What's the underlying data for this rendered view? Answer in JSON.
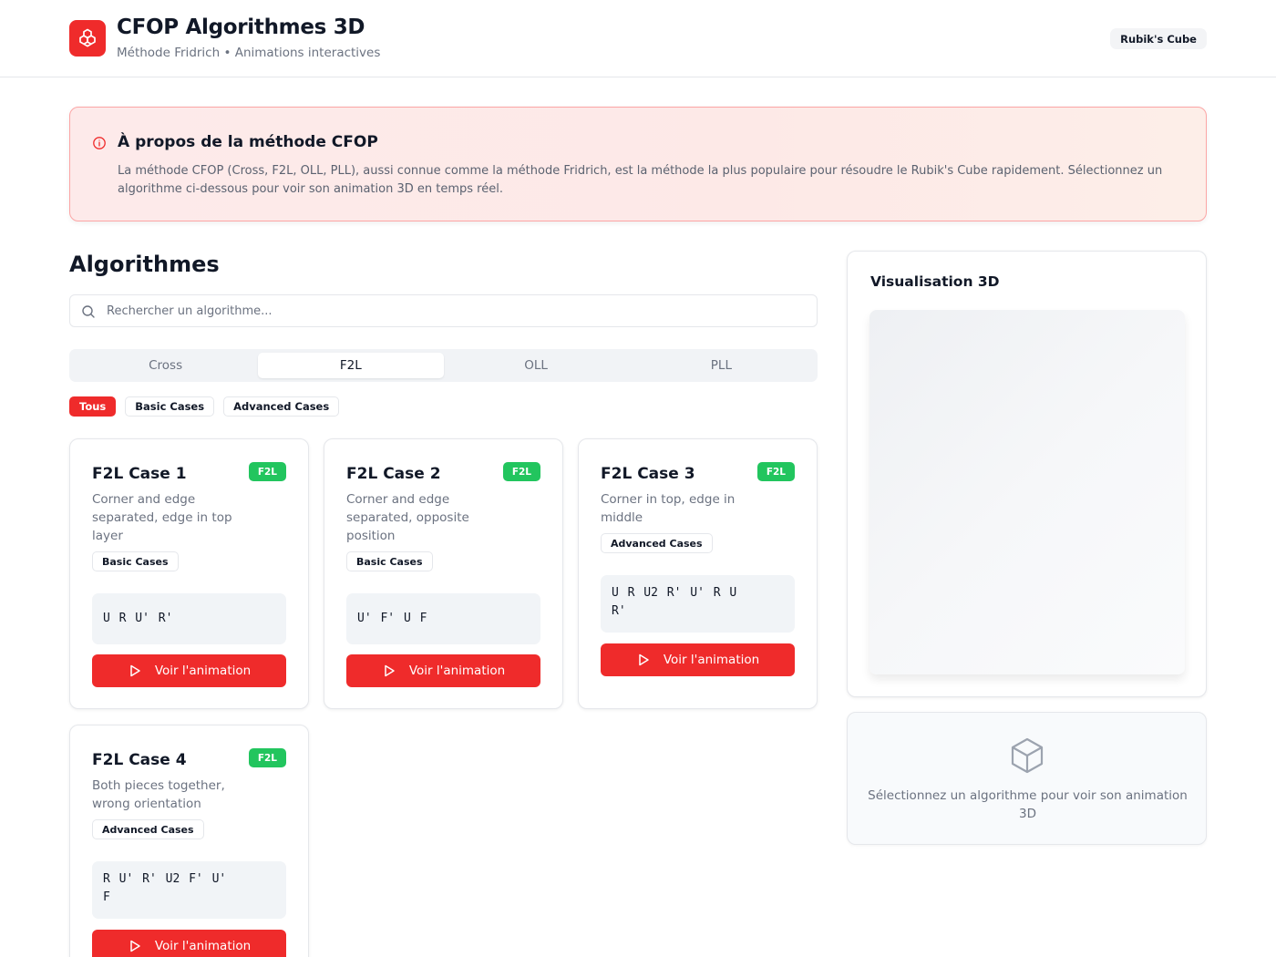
{
  "header": {
    "title": "CFOP Algorithmes 3D",
    "subtitle": "Méthode Fridrich • Animations interactives",
    "badge": "Rubik's Cube",
    "logo_icon": "cube-logo-icon",
    "brand_color": "#ef2b2b"
  },
  "info": {
    "icon": "info-icon",
    "title": "À propos de la méthode CFOP",
    "text": "La méthode CFOP (Cross, F2L, OLL, PLL), aussi connue comme la méthode Fridrich, est la méthode la plus populaire pour résoudre le Rubik's Cube rapidement. Sélectionnez un algorithme ci-dessous pour voir son animation 3D en temps réel."
  },
  "algorithms": {
    "title": "Algorithmes",
    "search_placeholder": "Rechercher un algorithme...",
    "search_value": "",
    "tabs": [
      {
        "label": "Cross",
        "active": false
      },
      {
        "label": "F2L",
        "active": true
      },
      {
        "label": "OLL",
        "active": false
      },
      {
        "label": "PLL",
        "active": false
      }
    ],
    "filters": [
      {
        "label": "Tous",
        "active": true
      },
      {
        "label": "Basic Cases",
        "active": false
      },
      {
        "label": "Advanced Cases",
        "active": false
      }
    ],
    "button_label": "Voir l'animation",
    "cards": [
      {
        "title": "F2L Case 1",
        "badge": "F2L",
        "description": "Corner and edge separated, edge in top layer",
        "tag": "Basic Cases",
        "moves": "U R U' R'"
      },
      {
        "title": "F2L Case 2",
        "badge": "F2L",
        "description": "Corner and edge separated, opposite position",
        "tag": "Basic Cases",
        "moves": "U' F' U F"
      },
      {
        "title": "F2L Case 3",
        "badge": "F2L",
        "description": "Corner in top, edge in middle",
        "tag": "Advanced Cases",
        "moves": "U R U2 R' U' R U R'"
      },
      {
        "title": "F2L Case 4",
        "badge": "F2L",
        "description": "Both pieces together, wrong orientation",
        "tag": "Advanced Cases",
        "moves": "R U' R' U2 F' U' F"
      }
    ]
  },
  "visualization": {
    "title": "Visualisation 3D",
    "placeholder_icon": "cube-icon",
    "placeholder_text": "Sélectionnez un algorithme pour voir son animation 3D"
  },
  "colors": {
    "accent": "#ef2b2b",
    "badge_green": "#22c55e"
  }
}
